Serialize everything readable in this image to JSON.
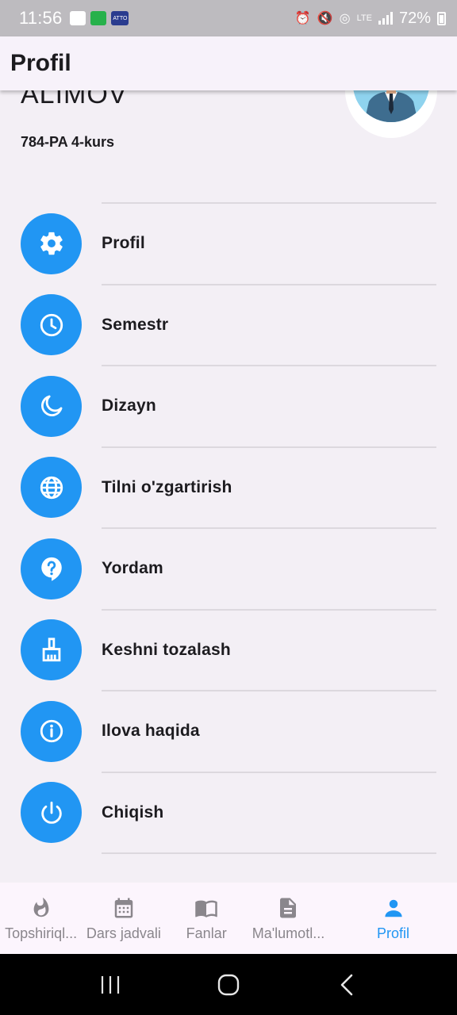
{
  "status_bar": {
    "time": "11:56",
    "atto_label": "ATTO",
    "network": "LTE",
    "battery": "72%"
  },
  "app_bar": {
    "title": "Profil"
  },
  "profile": {
    "name": "ALIMOV",
    "group": "784-PA 4-kurs"
  },
  "menu": {
    "items": [
      {
        "label": "Profil",
        "icon": "gear-icon"
      },
      {
        "label": "Semestr",
        "icon": "clock-icon"
      },
      {
        "label": "Dizayn",
        "icon": "moon-icon"
      },
      {
        "label": "Tilni o'zgartirish",
        "icon": "globe-icon"
      },
      {
        "label": "Yordam",
        "icon": "help-icon"
      },
      {
        "label": "Keshni tozalash",
        "icon": "broom-icon"
      },
      {
        "label": "Ilova haqida",
        "icon": "info-icon"
      },
      {
        "label": "Chiqish",
        "icon": "power-icon"
      }
    ]
  },
  "bottom_nav": {
    "items": [
      {
        "label": "Topshiriql...",
        "icon": "flame-icon",
        "active": false
      },
      {
        "label": "Dars jadvali",
        "icon": "calendar-icon",
        "active": false
      },
      {
        "label": "Fanlar",
        "icon": "book-icon",
        "active": false
      },
      {
        "label": "Ma'lumotl...",
        "icon": "document-icon",
        "active": false
      },
      {
        "label": "Profil",
        "icon": "person-icon",
        "active": true
      }
    ]
  },
  "colors": {
    "accent": "#2196f3",
    "background": "#f3eff5",
    "inactive": "#8a868c"
  }
}
